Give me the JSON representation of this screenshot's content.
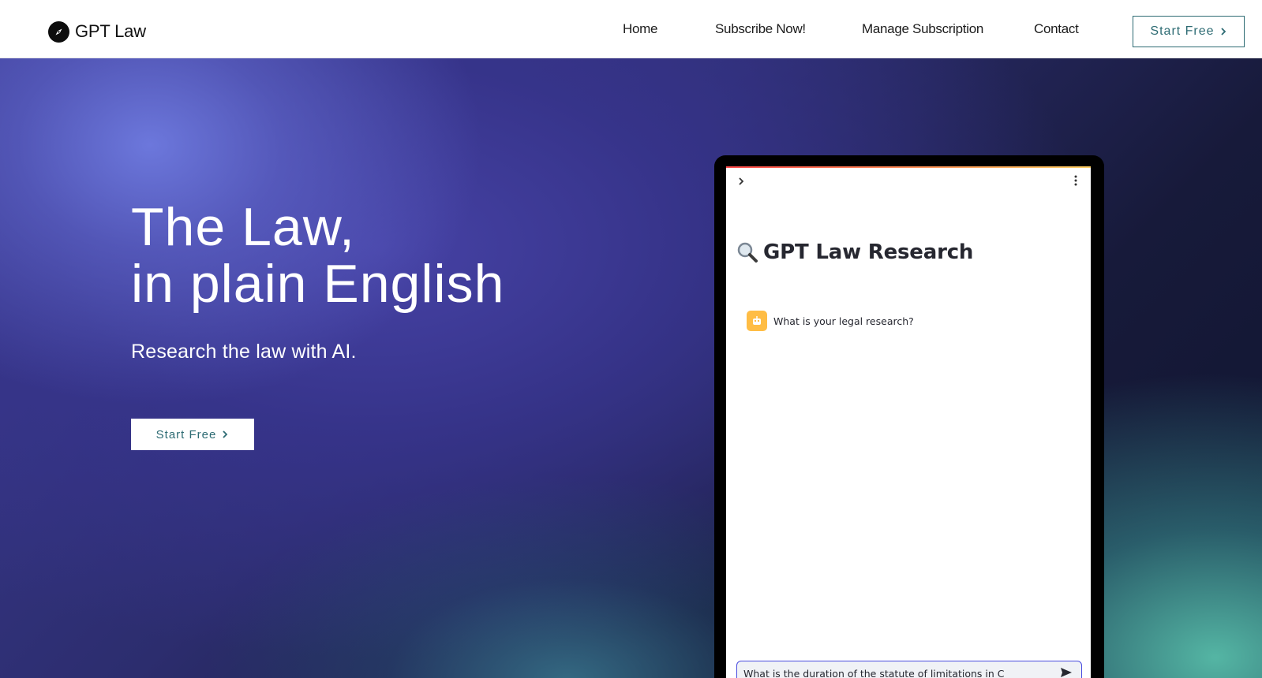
{
  "header": {
    "brand": "GPT Law",
    "nav": [
      "Home",
      "Subscribe Now!",
      "Manage Subscription",
      "Contact"
    ],
    "cta_label": "Start Free"
  },
  "hero": {
    "title_line1": "The Law,",
    "title_line2": "in plain English",
    "subtitle": "Research the law with AI.",
    "cta_label": "Start Free"
  },
  "device": {
    "app_title": "GPT Law Research",
    "assistant_message": "What is your legal research?",
    "input_value": "What is the duration of the statute of limitations in C"
  },
  "colors": {
    "accent": "#2d6b73",
    "header_bg": "#ffffff",
    "hero_dark": "#171a3a",
    "hero_violet": "#3b3a93",
    "hero_teal": "#58beaa",
    "assistant_avatar": "#ffbd45",
    "input_border": "#4a4de0"
  },
  "icons": {
    "logo": "compass-icon",
    "cta": "chevron-right-icon",
    "app_title": "magnifier-icon",
    "sidebar_toggle": "chevron-right-icon",
    "menu": "kebab-icon",
    "assistant": "bot-avatar-icon",
    "send": "send-icon"
  }
}
